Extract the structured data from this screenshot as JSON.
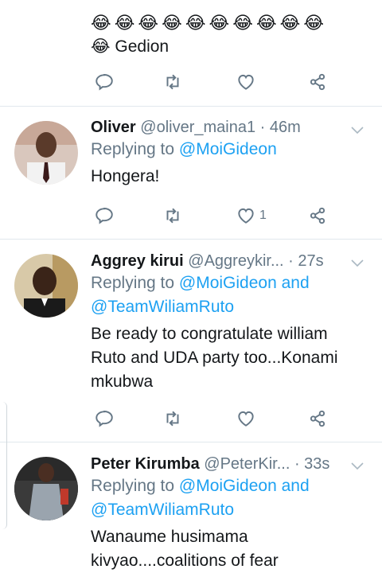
{
  "top_tweet": {
    "emoji_row": "😂😂😂😂😂😂😂😂😂😂",
    "last_line_emoji": "😂",
    "last_line_text": "Gedion"
  },
  "tweets": [
    {
      "name": "Oliver",
      "handle": "@oliver_maina1",
      "time": "· 46m",
      "replying_prefix": "Replying to ",
      "mentions": "@MoiGideon",
      "mentions2": "",
      "body": "Hongera!",
      "like_count": "1"
    },
    {
      "name": "Aggrey kirui",
      "handle": "@Aggreykir...",
      "time": "· 27s",
      "replying_prefix": "Replying to ",
      "mentions": "@MoiGideon and",
      "mentions2": "@TeamWiliamRuto",
      "body": "Be ready to congratulate william Ruto and UDA party too...Konami mkubwa",
      "like_count": ""
    },
    {
      "name": "Peter Kirumba",
      "handle": "@PeterKir...",
      "time": "· 33s",
      "replying_prefix": "Replying to ",
      "mentions": "@MoiGideon and",
      "mentions2": "@TeamWiliamRuto",
      "body": "Wanaume husimama kivyao....coalitions of fear",
      "like_count": ""
    }
  ],
  "colors": {
    "accent": "#1da1f2",
    "muted": "#657786",
    "divider": "#e1e8ed"
  }
}
